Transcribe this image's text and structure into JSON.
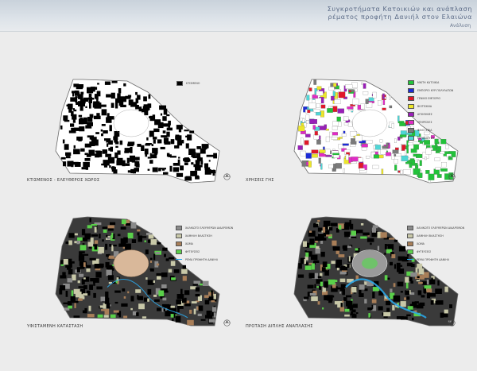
{
  "header": {
    "title_line1": "Συγκροτήματα Κατοικιών και ανάπλαση",
    "title_line2": "ρέματος προφήτη Δανιήλ στον Ελαιώνα",
    "section": "Ανάλυση"
  },
  "panels": [
    {
      "id": "built-free",
      "caption": "ΚΤΙΣΜΕΝΟΣ - ΕΛΕΥΘΕΡΟΣ ΧΩΡΟΣ",
      "legend": [
        {
          "label": "ΚΤΙΣΜΕΝΟ",
          "color": "#000000"
        }
      ]
    },
    {
      "id": "land-uses",
      "caption": "ΧΡΗΣΕΙΣ ΓΗΣ",
      "legend": [
        {
          "label": "ΜΙΚΤΗ ΚΑΤΟΙΚΙΑ",
          "color": "#22c23a"
        },
        {
          "label": "ΕΜΠΟΡΙΟ ΚΥΡ.ΠΟΛΥΛΑΤΩΝ",
          "color": "#1c2bd6"
        },
        {
          "label": "ΓΕΝΙΚΟ ΕΜΠΟΡΙΟ",
          "color": "#e0182a"
        },
        {
          "label": "ΒΙΟΤΕΧΝΙΑ",
          "color": "#ece62a"
        },
        {
          "label": "ΑΠΟΘΗΚΕΣ",
          "color": "#9a1fb8"
        },
        {
          "label": "ΥΠΗΡΕΣΙΕΣ",
          "color": "#e02cc4"
        },
        {
          "label": "ΦΙΛΟΞΕΝΙΑ",
          "color": "#7a7a7a"
        },
        {
          "label": "ΕΚΠΑΙΔΕΥΣΗ",
          "color": "#4fd6d6"
        }
      ]
    },
    {
      "id": "existing-state",
      "caption": "ΥΦΙΣΤΑΜΕΝΗ ΚΑΤΑΣΤΑΣΗ",
      "legend": [
        {
          "label": "ΧΑΛΙΚΩΤΟ ΕΛΕΥΘΕΡΩΝ ΔΙΑΔΡΟΜΩΝ",
          "color": "#8a8a8a",
          "kind": "box"
        },
        {
          "label": "ΧΑΜΗΛΗ ΒΛΑΣΤΗΣΗ",
          "color": "#c8c8a8",
          "kind": "box"
        },
        {
          "label": "ΧΩΜΑ",
          "color": "#a87e58",
          "kind": "box"
        },
        {
          "label": "ΦΥΤΕΥΣΕΙΣ",
          "color": "#5ad04a",
          "kind": "box"
        },
        {
          "label": "ΡΕΜΑ ΠΡΟΦΗΤΗ ΔΑΝΙΗΛ",
          "color": "#2aa6e8",
          "kind": "line"
        }
      ]
    },
    {
      "id": "proposal",
      "caption": "ΠΡΟΤΑΣΗ ΔΙΠΛΗΣ ΑΝΑΠΛΑΣΗΣ",
      "legend": [
        {
          "label": "ΧΑΛΙΚΩΤΟ ΕΛΕΥΘΕΡΩΝ ΔΙΑΔΡΟΜΩΝ",
          "color": "#8a8a8a",
          "kind": "box"
        },
        {
          "label": "ΧΑΜΗΛΗ ΒΛΑΣΤΗΣΗ",
          "color": "#c8c8a8",
          "kind": "box"
        },
        {
          "label": "ΧΩΜΑ",
          "color": "#a87e58",
          "kind": "box"
        },
        {
          "label": "ΦΥΤΕΥΣΕΙΣ",
          "color": "#5ad04a",
          "kind": "box"
        },
        {
          "label": "ΡΕΜΑ ΠΡΟΦΗΤΗ ΔΑΝΙΗΛ",
          "color": "#2aa6e8",
          "kind": "line"
        }
      ]
    }
  ],
  "colors": {
    "page_background": "#ececec",
    "header_text": "#5a6a86",
    "site_outline": "#6a6a6a",
    "built": "#000000",
    "free": "#ffffff",
    "block_gray": "#3a3a3a"
  },
  "icons": {
    "north_arrow": "north-arrow-icon"
  }
}
